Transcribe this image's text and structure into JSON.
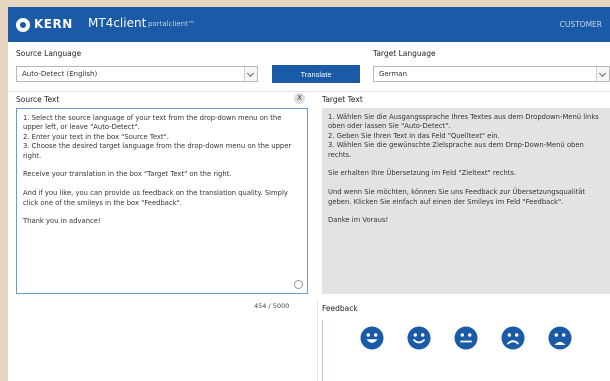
{
  "header": {
    "brand": "KERN",
    "app_name": "MT4client",
    "portal": "portalclient™",
    "user": "CUSTOMER"
  },
  "source_language": {
    "label": "Source Language",
    "value": "Auto-Detect (English)"
  },
  "target_language": {
    "label": "Target Language",
    "value": "German"
  },
  "translate_label": "Translate",
  "source_text": {
    "label": "Source Text",
    "clear": "X",
    "paragraphs": [
      "1. Select the source language of your text from the drop-down menu  on the upper left, or leave \"Auto-Detect\".",
      "2. Enter your text in the box \"Source Text\".",
      "3. Choose the desired target language from the drop-down menu on the upper right.",
      "Receive your translation in the box \"Target Text\" on the right.",
      "And if you like, you can provide us feedback on the translation quality. Simply click one of the smileys in the box \"Feedback\".",
      "Thank you in advance!"
    ],
    "counter": "454 / 5000"
  },
  "target_text": {
    "label": "Target Text",
    "paragraphs": [
      "1. Wählen Sie die Ausgangssprache Ihres Textes aus dem Dropdown-Menü links oben oder lassen Sie \"Auto-Detect\".",
      "2. Geben Sie Ihren Text in das Feld \"Quelltext\" ein.",
      "3. Wählen Sie die gewünschte Zielsprache aus dem Drop-Down-Menü oben rechts.",
      "Sie erhalten Ihre Übersetzung im Feld \"Zieltext\" rechts.",
      "Und wenn Sie möchten, können Sie uns Feedback zur Übersetzungsqualität geben. Klicken Sie einfach auf einen der Smileys im Feld \"Feedback\".",
      "Danke im Voraus!"
    ]
  },
  "feedback": {
    "label": "Feedback",
    "smileys": [
      "very-happy",
      "happy",
      "neutral",
      "sad",
      "very-sad"
    ]
  },
  "colors": {
    "brand": "#1a5aa6",
    "smiley": "#1a5aa6",
    "target_bg": "#e3e3e3",
    "outer_bg": "#e6d5bf"
  }
}
